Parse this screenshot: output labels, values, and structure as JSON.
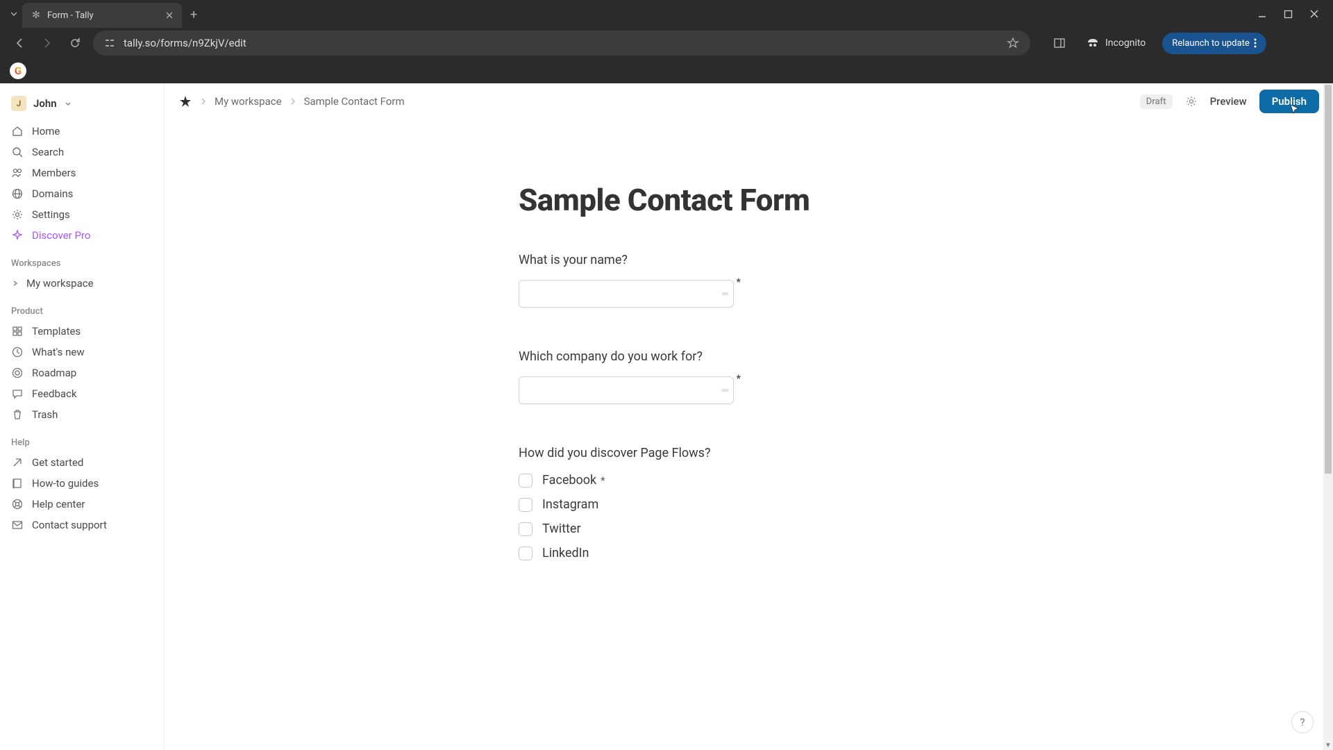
{
  "browser": {
    "tab_title": "Form - Tally",
    "url": "tally.so/forms/n9ZkjV/edit",
    "incognito_label": "Incognito",
    "relaunch_label": "Relaunch to update"
  },
  "sidebar": {
    "user": {
      "initial": "J",
      "name": "John"
    },
    "nav": [
      {
        "icon": "home",
        "label": "Home"
      },
      {
        "icon": "search",
        "label": "Search"
      },
      {
        "icon": "members",
        "label": "Members"
      },
      {
        "icon": "domains",
        "label": "Domains"
      },
      {
        "icon": "settings",
        "label": "Settings"
      },
      {
        "icon": "pro",
        "label": "Discover Pro"
      }
    ],
    "workspaces_label": "Workspaces",
    "workspace_name": "My workspace",
    "product_label": "Product",
    "product_items": [
      {
        "icon": "templates",
        "label": "Templates"
      },
      {
        "icon": "whatsnew",
        "label": "What's new"
      },
      {
        "icon": "roadmap",
        "label": "Roadmap"
      },
      {
        "icon": "feedback",
        "label": "Feedback"
      },
      {
        "icon": "trash",
        "label": "Trash"
      }
    ],
    "help_label": "Help",
    "help_items": [
      {
        "icon": "getstarted",
        "label": "Get started"
      },
      {
        "icon": "guides",
        "label": "How-to guides"
      },
      {
        "icon": "helpcenter",
        "label": "Help center"
      },
      {
        "icon": "contact",
        "label": "Contact support"
      }
    ]
  },
  "topbar": {
    "crumb1": "My workspace",
    "crumb2": "Sample Contact Form",
    "draft": "Draft",
    "preview": "Preview",
    "publish": "Publish"
  },
  "form": {
    "title": "Sample Contact Form",
    "q1": {
      "label": "What is your name?"
    },
    "q2": {
      "label": "Which company do you work for?"
    },
    "q3": {
      "label": "How did you discover Page Flows?",
      "options": [
        "Facebook",
        "Instagram",
        "Twitter",
        "LinkedIn"
      ]
    }
  },
  "help_fab": "?"
}
